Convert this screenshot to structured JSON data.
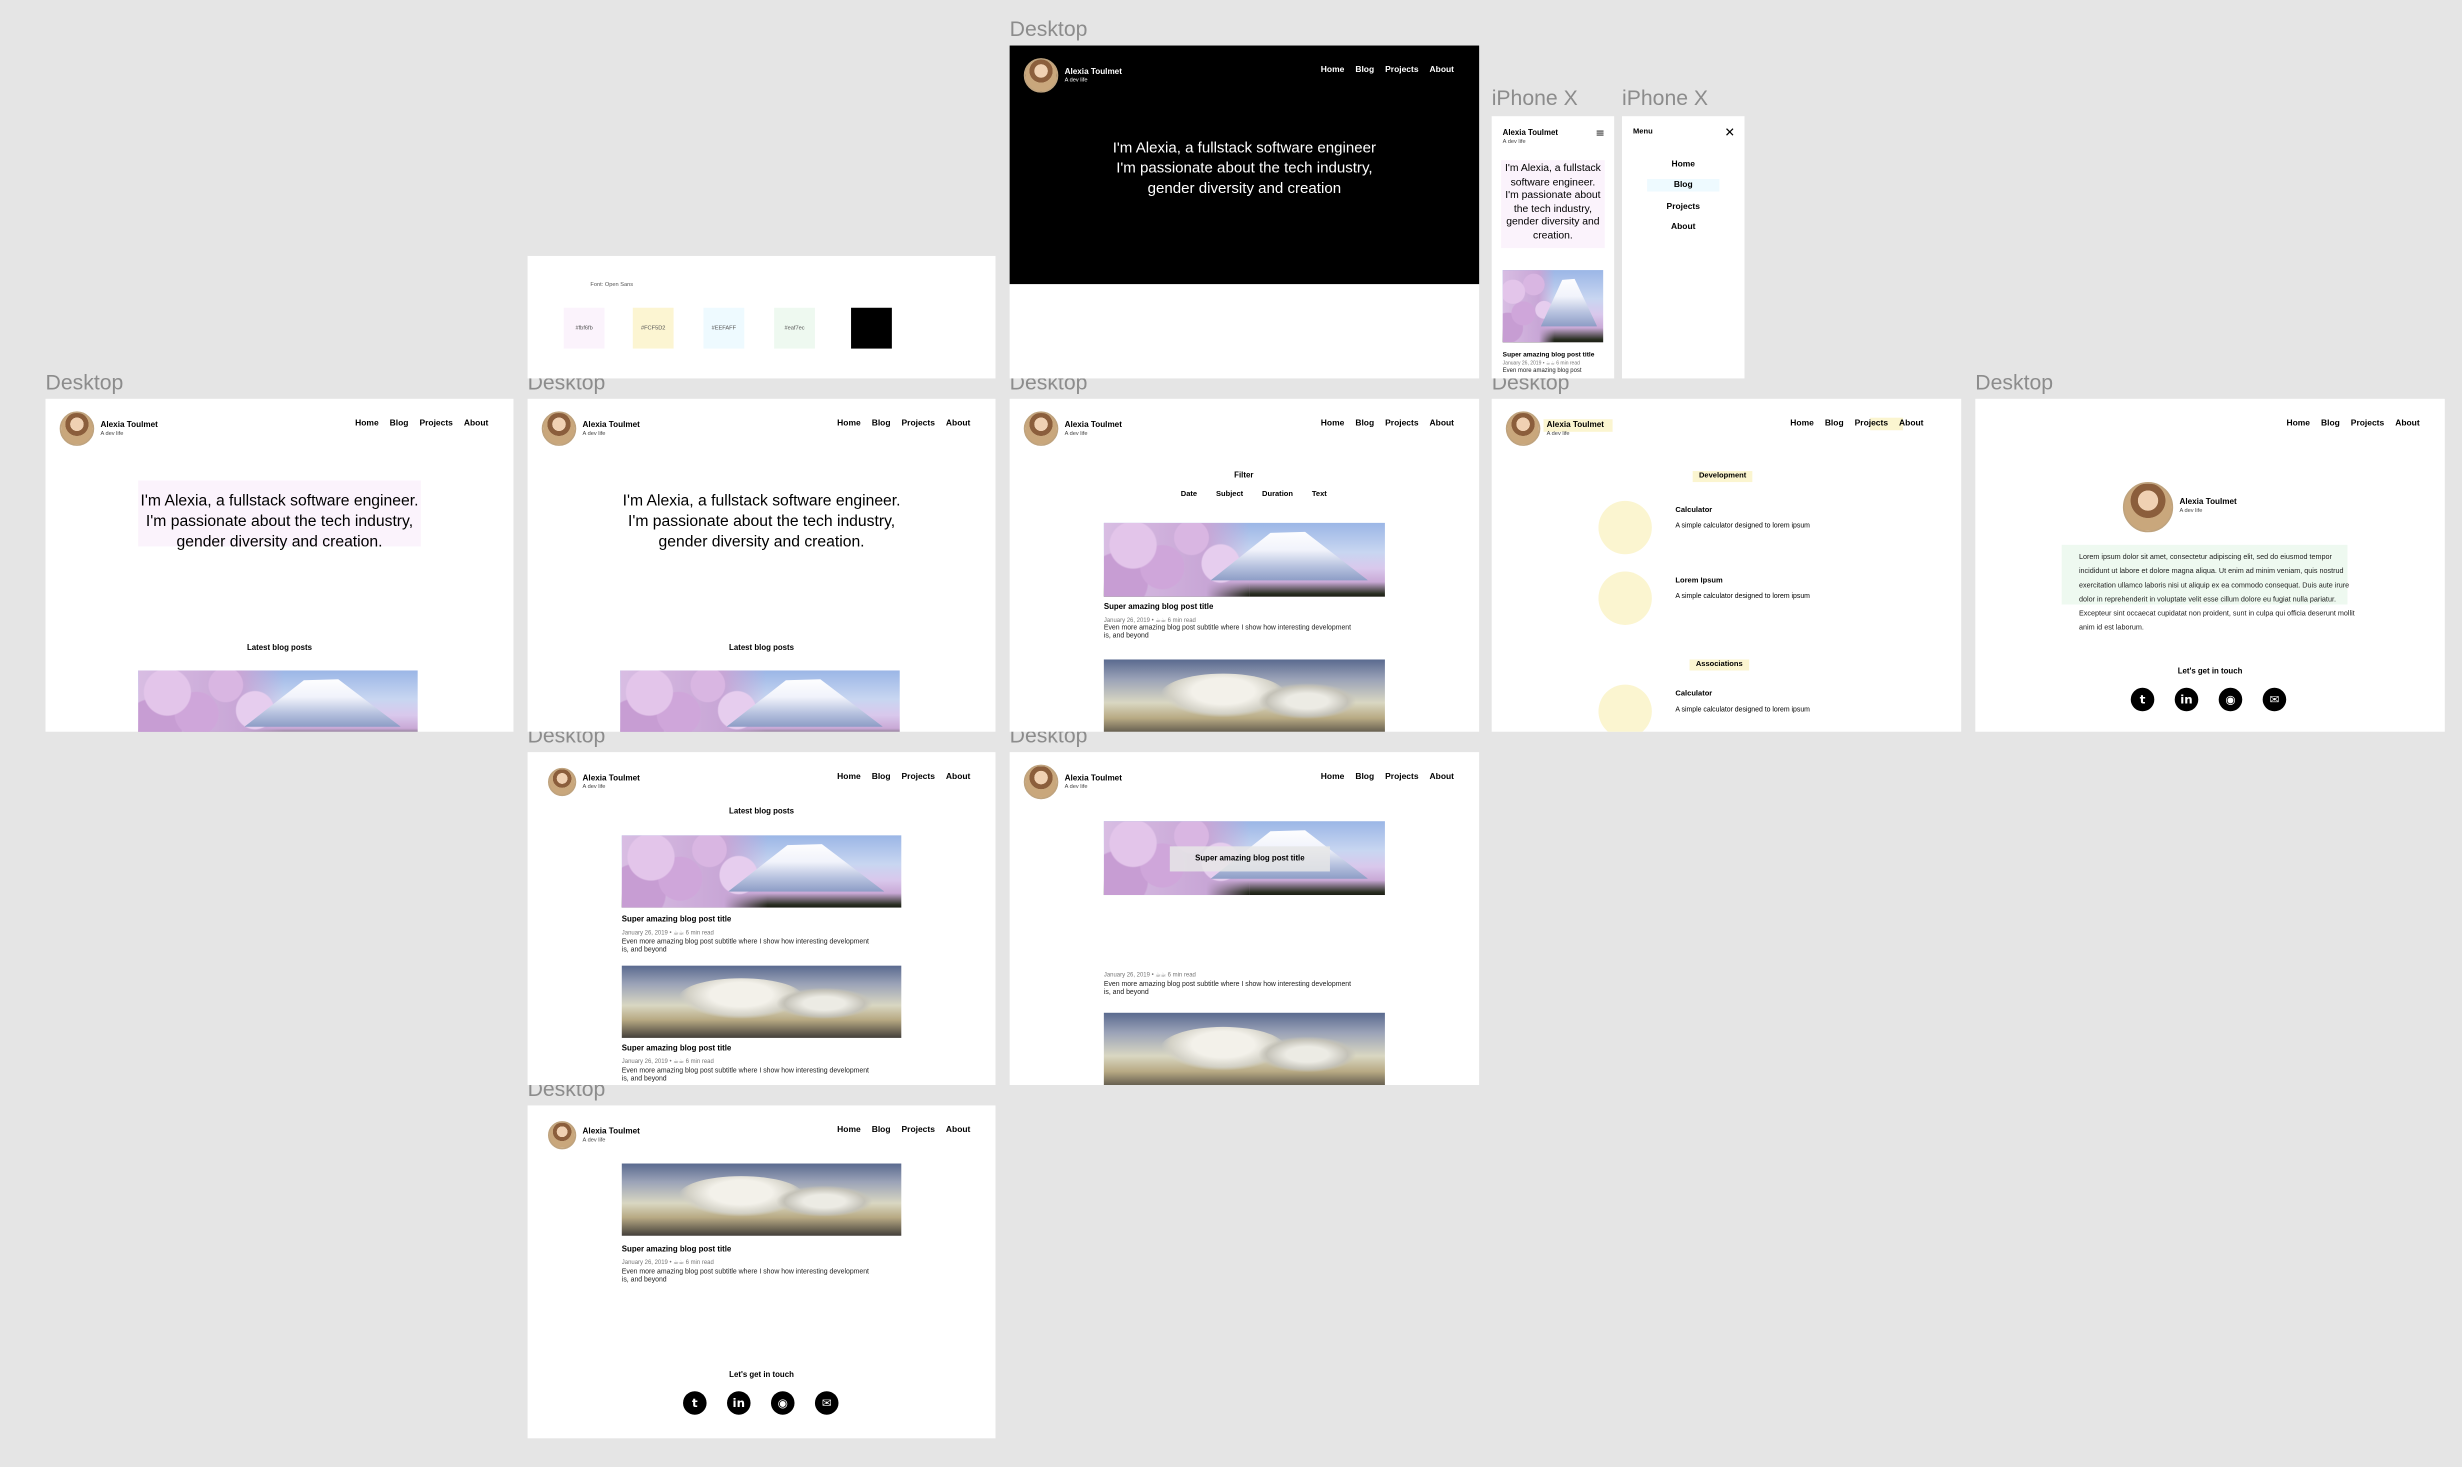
{
  "labels": {
    "desktop": "Desktop",
    "iphone": "iPhone X"
  },
  "site": {
    "name": "Alexia Toulmet",
    "tagline": "A dev life",
    "nav": [
      "Home",
      "Blog",
      "Projects",
      "About"
    ]
  },
  "hero": {
    "dark_line1": "I'm Alexia, a fullstack software engineer",
    "dark_line2": "I'm passionate about the tech industry,",
    "dark_line3": "gender diversity and creation",
    "line1": "I'm Alexia, a fullstack software engineer.",
    "line2": "I'm passionate about the tech industry,",
    "line3": "gender diversity and creation."
  },
  "styleguide": {
    "font_label": "Font: Open Sans",
    "swatches": [
      {
        "label": "#fbf6fb",
        "color": "#fbf3fc"
      },
      {
        "label": "#FCF5D2",
        "color": "#fcf5d2"
      },
      {
        "label": "#EEFAFF",
        "color": "#eefaff"
      },
      {
        "label": "#eaf7ec",
        "color": "#eef9f0"
      },
      {
        "label": "",
        "color": "#000000"
      }
    ]
  },
  "blog": {
    "section_title": "Latest blog posts",
    "post_title": "Super amazing blog post title",
    "post_meta": "January 26, 2019 • ☕☕ 6 min read",
    "post_subtitle_1": "Even more amazing blog post subtitle where I show how interesting development",
    "post_subtitle_2": "is, and beyond",
    "overlay_title": "Super amazing blog post title"
  },
  "filter": {
    "title": "Filter",
    "options": [
      "Date",
      "Subject",
      "Duration",
      "Text"
    ]
  },
  "projects": {
    "cat_development": "Development",
    "cat_associations": "Associations",
    "items": [
      {
        "name": "Calculator",
        "desc": "A simple calculator designed to lorem ipsum"
      },
      {
        "name": "Lorem Ipsum",
        "desc": "A simple calculator designed to lorem ipsum"
      },
      {
        "name": "Calculator",
        "desc": "A simple calculator designed to lorem ipsum"
      }
    ]
  },
  "about": {
    "text": "Lorem ipsum dolor sit amet, consectetur adipiscing elit, sed do eiusmod tempor incididunt ut labore et dolore magna aliqua. Ut enim ad minim veniam, quis nostrud exercitation ullamco laboris nisi ut aliquip ex ea commodo consequat. Duis aute irure dolor in reprehenderit in voluptate velit esse cillum dolore eu fugiat nulla pariatur. Excepteur sint occaecat cupidatat non proident, sunt in culpa qui officia deserunt mollit anim id est laborum."
  },
  "contact": {
    "title": "Let's get in touch",
    "icons": [
      "twitter-icon",
      "linkedin-icon",
      "github-icon",
      "email-icon"
    ]
  },
  "mobile": {
    "hero_1": "I'm Alexia, a fullstack",
    "hero_2": "software engineer.",
    "hero_3": "I'm passionate about",
    "hero_4": "the tech industry,",
    "hero_5": "gender diversity and",
    "hero_6": "creation.",
    "post_title": "Super amazing blog post title",
    "post_meta": "January 26, 2019 • ☕☕ 6 min read",
    "post_sub": "Even more amazing blog post",
    "menu_title": "Menu",
    "menu_items": [
      "Home",
      "Blog",
      "Projects",
      "About"
    ]
  },
  "colors": {
    "canvas": "#e5e5e5",
    "pink": "#fbf3fc",
    "yellow": "#fbf5d0",
    "green": "#eef9f0",
    "blue_highlight": "#eefaff"
  }
}
